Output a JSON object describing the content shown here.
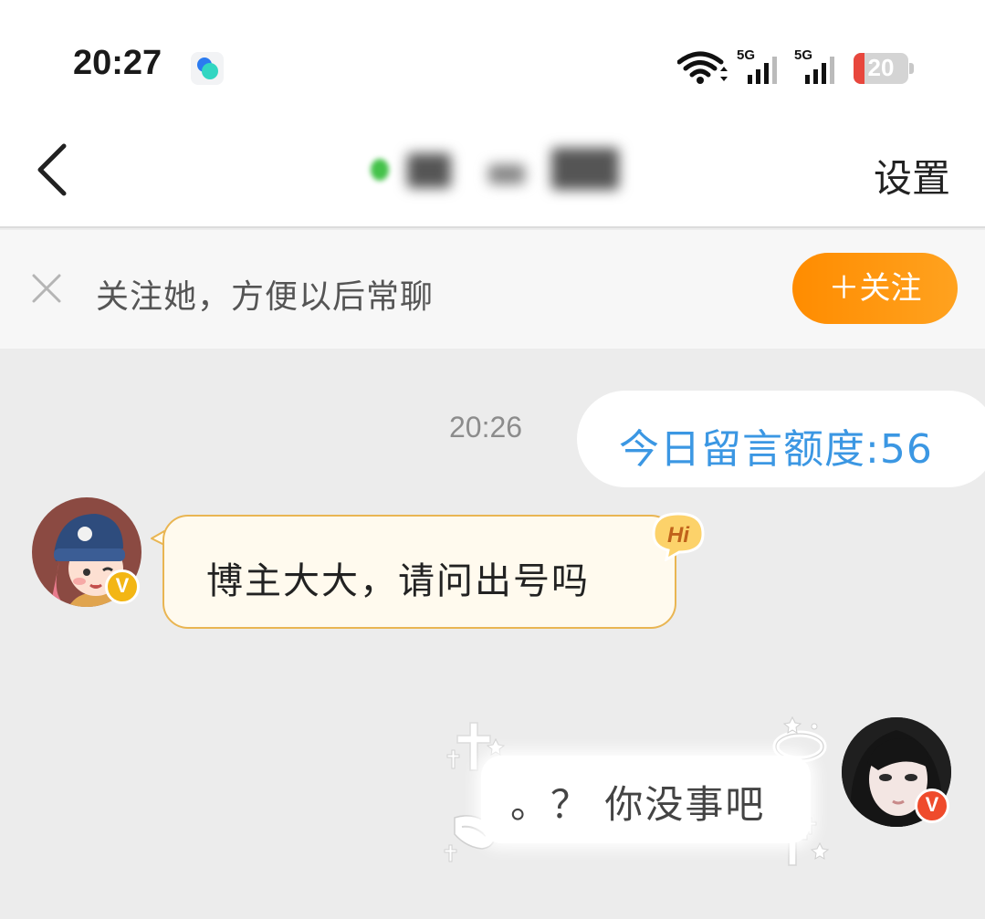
{
  "status_bar": {
    "time": "20:27",
    "signal_1_label": "5G",
    "signal_2_label": "5G",
    "battery_level": "20",
    "battery_fraction": 0.2
  },
  "nav": {
    "back_icon": "chevron-left-icon",
    "settings_label": "设置"
  },
  "follow_bar": {
    "text": "关注她，方便以后常聊",
    "button_label": "＋关注",
    "button_color": "#ff8c00"
  },
  "chat": {
    "messages": [
      {
        "time": "20:26",
        "text": "今日留言额度:56",
        "color": "#3b97e3"
      },
      {
        "text": "博主大大，请问出号吗",
        "badge": "V",
        "corner_icon_text": "Hi"
      },
      {
        "text": "。？ 你没事吧",
        "badge": "V"
      }
    ]
  }
}
